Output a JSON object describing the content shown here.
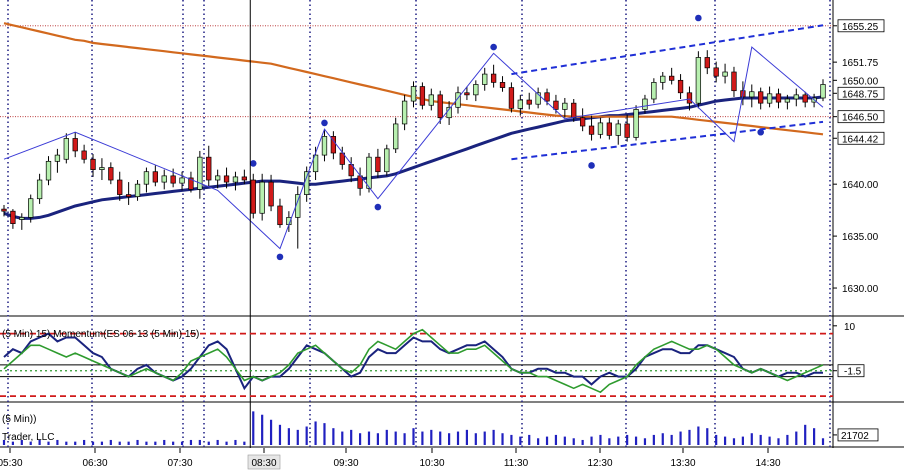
{
  "chart_data": {
    "type": "candlestick",
    "price_axis": {
      "ticks": [
        "1655.25",
        "1651.75",
        "1650.00",
        "1648.75",
        "1646.50",
        "1644.42",
        "1640.00",
        "1635.00",
        "1630.00"
      ],
      "range": [
        1627.5,
        1656.0
      ]
    },
    "time_axis": {
      "ticks": [
        "05:30",
        "06:30",
        "07:30",
        "08:30",
        "09:30",
        "10:30",
        "11:30",
        "12:30",
        "13:30",
        "14:30"
      ],
      "highlighted": "08:30"
    },
    "candles": [
      [
        1637.6,
        1638.0,
        1636.9,
        1637.4
      ],
      [
        1637.4,
        1637.6,
        1635.7,
        1636.2
      ],
      [
        1636.6,
        1637.2,
        1635.6,
        1636.8
      ],
      [
        1636.8,
        1639.0,
        1636.3,
        1638.6
      ],
      [
        1638.6,
        1641.0,
        1638.1,
        1640.4
      ],
      [
        1640.4,
        1642.7,
        1639.9,
        1642.2
      ],
      [
        1642.2,
        1643.4,
        1641.1,
        1642.8
      ],
      [
        1642.4,
        1644.9,
        1642.0,
        1644.4
      ],
      [
        1644.4,
        1645.0,
        1642.6,
        1643.2
      ],
      [
        1643.2,
        1643.8,
        1642.0,
        1642.4
      ],
      [
        1642.4,
        1642.9,
        1640.7,
        1641.4
      ],
      [
        1641.4,
        1642.5,
        1640.4,
        1641.6
      ],
      [
        1641.6,
        1642.1,
        1640.0,
        1640.4
      ],
      [
        1640.4,
        1641.2,
        1638.4,
        1639.0
      ],
      [
        1639.0,
        1640.2,
        1638.0,
        1638.8
      ],
      [
        1638.8,
        1640.4,
        1638.4,
        1640.0
      ],
      [
        1640.0,
        1641.6,
        1639.2,
        1641.2
      ],
      [
        1641.2,
        1641.8,
        1639.8,
        1640.2
      ],
      [
        1640.2,
        1641.4,
        1639.5,
        1640.8
      ],
      [
        1640.8,
        1641.5,
        1639.7,
        1640.1
      ],
      [
        1640.1,
        1641.2,
        1639.4,
        1640.6
      ],
      [
        1640.6,
        1641.2,
        1639.2,
        1639.5
      ],
      [
        1639.5,
        1643.2,
        1638.6,
        1642.6
      ],
      [
        1642.6,
        1643.7,
        1639.8,
        1640.4
      ],
      [
        1640.4,
        1641.4,
        1639.6,
        1640.8
      ],
      [
        1640.8,
        1641.6,
        1639.6,
        1640.2
      ],
      [
        1640.2,
        1641.2,
        1639.4,
        1640.7
      ],
      [
        1640.7,
        1641.4,
        1640.0,
        1640.4
      ],
      [
        1640.4,
        1641.0,
        1636.7,
        1637.2
      ],
      [
        1637.2,
        1641.0,
        1636.5,
        1640.2
      ],
      [
        1640.2,
        1640.9,
        1637.4,
        1637.9
      ],
      [
        1637.9,
        1638.6,
        1635.8,
        1636.1
      ],
      [
        1636.1,
        1637.4,
        1635.4,
        1636.8
      ],
      [
        1636.8,
        1639.8,
        1633.8,
        1639.0
      ],
      [
        1639.0,
        1641.7,
        1638.3,
        1641.2
      ],
      [
        1641.2,
        1643.6,
        1640.4,
        1642.8
      ],
      [
        1642.8,
        1645.3,
        1642.2,
        1644.6
      ],
      [
        1644.6,
        1645.1,
        1642.4,
        1643.0
      ],
      [
        1643.0,
        1643.6,
        1641.4,
        1641.9
      ],
      [
        1641.9,
        1642.6,
        1640.2,
        1640.8
      ],
      [
        1640.8,
        1641.6,
        1638.9,
        1639.6
      ],
      [
        1639.6,
        1643.0,
        1639.2,
        1642.6
      ],
      [
        1642.6,
        1643.4,
        1640.6,
        1641.2
      ],
      [
        1641.2,
        1643.8,
        1640.8,
        1643.4
      ],
      [
        1643.4,
        1646.4,
        1643.0,
        1645.8
      ],
      [
        1645.8,
        1648.6,
        1645.2,
        1648.0
      ],
      [
        1648.0,
        1649.9,
        1647.4,
        1649.4
      ],
      [
        1649.4,
        1649.8,
        1647.2,
        1647.6
      ],
      [
        1647.6,
        1649.2,
        1647.1,
        1648.6
      ],
      [
        1648.6,
        1649.0,
        1645.8,
        1646.4
      ],
      [
        1646.4,
        1648.0,
        1645.7,
        1647.4
      ],
      [
        1647.4,
        1649.4,
        1646.8,
        1648.8
      ],
      [
        1648.8,
        1649.4,
        1648.1,
        1648.6
      ],
      [
        1648.6,
        1650.0,
        1648.0,
        1649.6
      ],
      [
        1649.6,
        1651.2,
        1649.0,
        1650.6
      ],
      [
        1650.6,
        1651.5,
        1649.3,
        1649.8
      ],
      [
        1649.8,
        1650.4,
        1648.9,
        1649.3
      ],
      [
        1649.3,
        1649.8,
        1646.9,
        1647.3
      ],
      [
        1647.3,
        1648.6,
        1646.6,
        1648.1
      ],
      [
        1648.1,
        1648.8,
        1647.2,
        1647.7
      ],
      [
        1647.7,
        1649.3,
        1647.3,
        1648.8
      ],
      [
        1648.8,
        1649.2,
        1647.6,
        1648.0
      ],
      [
        1648.0,
        1648.6,
        1646.8,
        1647.2
      ],
      [
        1647.2,
        1648.3,
        1646.4,
        1647.8
      ],
      [
        1647.8,
        1648.2,
        1646.0,
        1646.4
      ],
      [
        1646.4,
        1647.3,
        1645.1,
        1645.6
      ],
      [
        1645.6,
        1646.6,
        1644.2,
        1644.8
      ],
      [
        1644.8,
        1646.4,
        1644.4,
        1645.9
      ],
      [
        1645.9,
        1646.4,
        1644.3,
        1644.7
      ],
      [
        1644.7,
        1646.2,
        1643.8,
        1645.8
      ],
      [
        1645.8,
        1646.7,
        1644.1,
        1644.5
      ],
      [
        1644.5,
        1647.6,
        1644.2,
        1647.2
      ],
      [
        1647.2,
        1648.6,
        1646.8,
        1648.2
      ],
      [
        1648.2,
        1650.2,
        1647.8,
        1649.8
      ],
      [
        1649.8,
        1650.8,
        1649.1,
        1650.4
      ],
      [
        1650.4,
        1651.2,
        1649.6,
        1650.0
      ],
      [
        1650.0,
        1650.6,
        1648.2,
        1648.8
      ],
      [
        1648.8,
        1649.4,
        1647.1,
        1647.8
      ],
      [
        1647.8,
        1652.8,
        1647.3,
        1652.2
      ],
      [
        1652.2,
        1652.9,
        1650.6,
        1651.2
      ],
      [
        1651.2,
        1651.8,
        1649.8,
        1650.4
      ],
      [
        1650.4,
        1651.6,
        1649.7,
        1650.8
      ],
      [
        1650.8,
        1651.3,
        1648.4,
        1649.0
      ],
      [
        1649.0,
        1649.9,
        1647.6,
        1648.4
      ],
      [
        1648.4,
        1649.6,
        1647.4,
        1648.9
      ],
      [
        1648.9,
        1649.3,
        1647.2,
        1647.8
      ],
      [
        1647.8,
        1649.4,
        1647.4,
        1648.7
      ],
      [
        1648.7,
        1649.2,
        1647.3,
        1647.9
      ],
      [
        1647.9,
        1648.6,
        1647.2,
        1648.2
      ],
      [
        1648.2,
        1649.2,
        1647.5,
        1648.6
      ],
      [
        1648.6,
        1648.9,
        1647.4,
        1647.9
      ],
      [
        1647.9,
        1648.7,
        1647.4,
        1648.3
      ],
      [
        1648.3,
        1650.1,
        1648.0,
        1649.6
      ]
    ],
    "moving_averages": [
      {
        "color": "#1a237e",
        "values": [
          1637.2,
          1636.9,
          1636.7,
          1636.7,
          1636.8,
          1637.0,
          1637.3,
          1637.6,
          1637.9,
          1638.1,
          1638.3,
          1638.5,
          1638.6,
          1638.7,
          1638.8,
          1638.9,
          1639.0,
          1639.1,
          1639.2,
          1639.3,
          1639.4,
          1639.5,
          1639.6,
          1639.7,
          1639.8,
          1639.9,
          1640.0,
          1640.1,
          1640.2,
          1640.3,
          1640.3,
          1640.3,
          1640.2,
          1640.1,
          1640.0,
          1640.0,
          1640.1,
          1640.2,
          1640.3,
          1640.4,
          1640.5,
          1640.6,
          1640.7,
          1640.8,
          1641.0,
          1641.3,
          1641.6,
          1641.9,
          1642.2,
          1642.5,
          1642.8,
          1643.1,
          1643.4,
          1643.7,
          1644.0,
          1644.3,
          1644.6,
          1644.9,
          1645.1,
          1645.3,
          1645.5,
          1645.7,
          1645.9,
          1646.1,
          1646.2,
          1646.3,
          1646.4,
          1646.5,
          1646.6,
          1646.6,
          1646.7,
          1646.8,
          1646.9,
          1647.0,
          1647.1,
          1647.2,
          1647.3,
          1647.4,
          1647.6,
          1647.8,
          1648.0,
          1648.1,
          1648.2,
          1648.3,
          1648.3,
          1648.3,
          1648.3,
          1648.3,
          1648.3,
          1648.3,
          1648.3,
          1648.3,
          1648.4
        ]
      },
      {
        "color": "#d2691e",
        "values": [
          1655.5,
          1655.3,
          1655.1,
          1654.9,
          1654.7,
          1654.5,
          1654.3,
          1654.1,
          1653.9,
          1653.8,
          1653.6,
          1653.5,
          1653.4,
          1653.3,
          1653.2,
          1653.1,
          1653.0,
          1652.9,
          1652.8,
          1652.7,
          1652.6,
          1652.5,
          1652.4,
          1652.3,
          1652.2,
          1652.1,
          1652.0,
          1651.9,
          1651.8,
          1651.7,
          1651.6,
          1651.4,
          1651.2,
          1651.0,
          1650.8,
          1650.6,
          1650.4,
          1650.2,
          1650.0,
          1649.8,
          1649.6,
          1649.4,
          1649.2,
          1649.0,
          1648.8,
          1648.6,
          1648.4,
          1648.2,
          1648.0,
          1647.9,
          1647.8,
          1647.7,
          1647.6,
          1647.5,
          1647.4,
          1647.3,
          1647.2,
          1647.1,
          1647.0,
          1646.9,
          1646.8,
          1646.7,
          1646.6,
          1646.55,
          1646.5,
          1646.5,
          1646.5,
          1646.5,
          1646.5,
          1646.5,
          1646.5,
          1646.5,
          1646.5,
          1646.5,
          1646.5,
          1646.5,
          1646.4,
          1646.3,
          1646.2,
          1646.1,
          1646.0,
          1645.9,
          1645.8,
          1645.7,
          1645.6,
          1645.5,
          1645.4,
          1645.3,
          1645.2,
          1645.1,
          1645.0,
          1644.9,
          1644.8
        ]
      }
    ],
    "zigzag": [
      [
        0,
        1642.4
      ],
      [
        8,
        1645.0
      ],
      [
        24,
        1639.4
      ],
      [
        31,
        1633.8
      ],
      [
        36,
        1645.3
      ],
      [
        42,
        1638.6
      ],
      [
        55,
        1652.6
      ],
      [
        63,
        1646.3
      ],
      [
        77,
        1648.2
      ],
      [
        82,
        1644.1
      ],
      [
        84,
        1653.2
      ],
      [
        92,
        1647.4
      ]
    ],
    "swing_points": [
      [
        36,
        1645.9
      ],
      [
        42,
        1637.8
      ],
      [
        31,
        1633.0
      ],
      [
        28,
        1642.0
      ],
      [
        55,
        1653.2
      ],
      [
        66,
        1641.8
      ],
      [
        78,
        1656.0
      ],
      [
        85,
        1645.0
      ]
    ],
    "channel": {
      "upper": [
        [
          57,
          1650.6
        ],
        [
          92,
          1655.3
        ]
      ],
      "lower": [
        [
          57,
          1642.4
        ],
        [
          92,
          1646.0
        ]
      ]
    },
    "hlines": [
      1646.5,
      1655.25
    ],
    "session_breaks": [
      1,
      2,
      9,
      10,
      16,
      17,
      23,
      27,
      28,
      35,
      36,
      43,
      44,
      52,
      53,
      60,
      61,
      68,
      70,
      71,
      78,
      79,
      86,
      87
    ],
    "crosshair_index": 28,
    "momentum": {
      "ticks": [
        "10",
        "-1.5"
      ],
      "legend": "(5 Min) 15)  Momentum(ES 06-13 (5 Min) 15)",
      "series": [
        {
          "color": "#1a237e",
          "values": [
            2,
            4,
            3,
            6,
            7,
            8,
            6,
            7,
            7,
            5,
            3,
            2,
            -1,
            -2,
            -3,
            -1,
            0,
            -2,
            -3,
            -4,
            -3,
            -1,
            2,
            5,
            6,
            4,
            -1,
            -6,
            -3,
            -4,
            -3,
            -3,
            -1,
            2,
            5,
            4,
            3,
            1,
            -1,
            -3,
            -2,
            2,
            4,
            3,
            3,
            5,
            7,
            6,
            6,
            4,
            3,
            4,
            5,
            5,
            6,
            4,
            2,
            -1,
            -2,
            -2,
            -1,
            -1,
            -2,
            -2,
            -3,
            -3,
            -5,
            -3,
            -2,
            -3,
            -3,
            -1,
            2,
            3,
            4,
            4,
            3,
            3,
            5,
            5,
            4,
            3,
            2,
            -1,
            -2,
            -1,
            -2,
            -3,
            -2,
            -2,
            -3,
            -2,
            -2
          ]
        },
        {
          "color": "#2e9b2e",
          "values": [
            -1,
            1,
            3,
            5,
            5,
            4,
            3,
            2,
            3,
            2,
            1,
            0,
            -1,
            -2,
            -3,
            -2,
            -1,
            -2,
            -3,
            -4,
            -2,
            1,
            2,
            3,
            4,
            2,
            -1,
            -4,
            -3,
            -4,
            -3,
            -2,
            0,
            3,
            4,
            5,
            3,
            1,
            -1,
            -2,
            0,
            4,
            6,
            5,
            4,
            6,
            8,
            9,
            7,
            5,
            3,
            3,
            4,
            4,
            5,
            3,
            1,
            -1,
            -2,
            -2,
            -3,
            -3,
            -4,
            -5,
            -6,
            -5,
            -6,
            -7,
            -5,
            -4,
            -3,
            0,
            2,
            4,
            5,
            6,
            5,
            4,
            4,
            5,
            4,
            2,
            0,
            -1,
            -2,
            -1,
            -2,
            -3,
            -4,
            -3,
            -2,
            -1,
            0
          ]
        }
      ]
    },
    "volume": {
      "tick": "21702",
      "legend_lines": [
        "(5 Min))",
        "Trader, LLC"
      ],
      "values": [
        3,
        2,
        3,
        2,
        3,
        2,
        3,
        2,
        2,
        3,
        2,
        2,
        3,
        2,
        2,
        3,
        2,
        2,
        3,
        2,
        2,
        3,
        3,
        2,
        3,
        2,
        3,
        2,
        20,
        18,
        15,
        12,
        10,
        9,
        11,
        14,
        13,
        10,
        8,
        9,
        7,
        8,
        7,
        9,
        8,
        7,
        10,
        8,
        9,
        8,
        7,
        8,
        9,
        7,
        8,
        9,
        7,
        6,
        5,
        6,
        4,
        5,
        6,
        5,
        4,
        3,
        5,
        6,
        4,
        5,
        6,
        5,
        4,
        6,
        7,
        6,
        8,
        9,
        11,
        10,
        6,
        5,
        4,
        5,
        7,
        6,
        5,
        4,
        6,
        8,
        12,
        10,
        4
      ]
    }
  }
}
